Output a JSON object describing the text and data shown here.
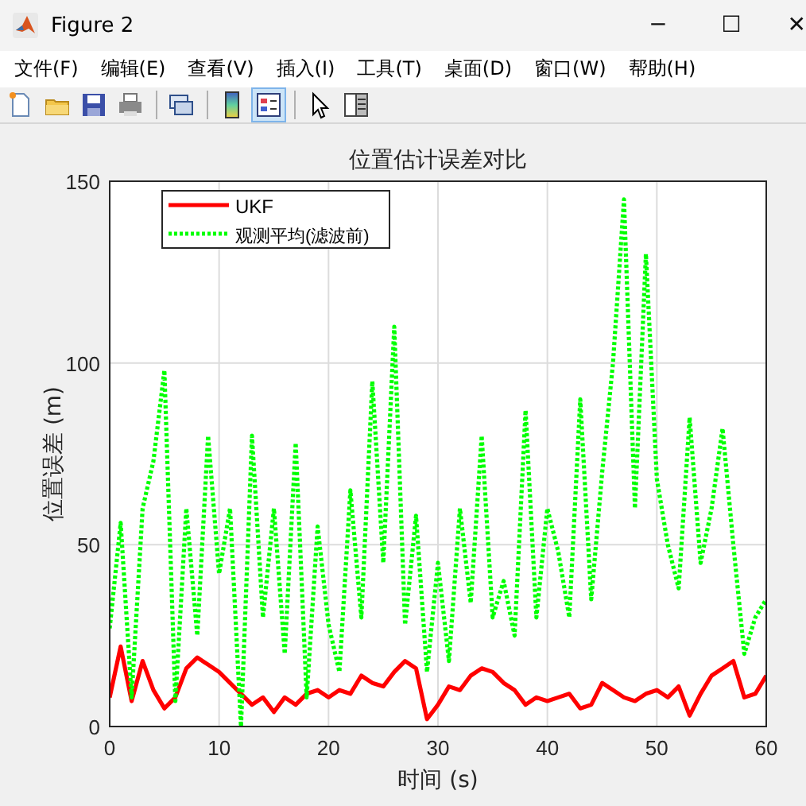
{
  "window": {
    "title": "Figure 2",
    "controls": [
      "─",
      "☐",
      "✕"
    ]
  },
  "menu": [
    "文件(F)",
    "编辑(E)",
    "查看(V)",
    "插入(I)",
    "工具(T)",
    "桌面(D)",
    "窗口(W)",
    "帮助(H)"
  ],
  "toolbar": [
    {
      "selected": false
    },
    {
      "selected": false
    },
    {
      "selected": false
    },
    {
      "selected": false
    },
    {
      "selected": false
    },
    {
      "selected": false
    },
    {
      "selected": true
    },
    {
      "selected": false
    },
    {
      "selected": false
    }
  ],
  "plot": {
    "chart_data": {
      "type": "line",
      "title": "位置估计误差对比",
      "xlabel": "时间 (s)",
      "ylabel": "位置误差 (m)",
      "x": [
        0,
        1,
        2,
        3,
        4,
        5,
        6,
        7,
        8,
        9,
        10,
        11,
        12,
        13,
        14,
        15,
        16,
        17,
        18,
        19,
        20,
        21,
        22,
        23,
        24,
        25,
        26,
        27,
        28,
        29,
        30,
        31,
        32,
        33,
        34,
        35,
        36,
        37,
        38,
        39,
        40,
        41,
        42,
        43,
        44,
        45,
        46,
        47,
        48,
        49,
        50,
        51,
        52,
        53,
        54,
        55,
        56,
        57,
        58,
        59,
        60
      ],
      "series": [
        {
          "name": "UKF",
          "color": "#ff0000",
          "line_style": "solid",
          "values": [
            8,
            22,
            7,
            18,
            10,
            5,
            8,
            16,
            19,
            17,
            15,
            12,
            9,
            6,
            8,
            4,
            8,
            6,
            9,
            10,
            8,
            10,
            9,
            14,
            12,
            11,
            15,
            18,
            16,
            2,
            6,
            11,
            10,
            14,
            16,
            15,
            12,
            10,
            6,
            8,
            7,
            8,
            9,
            5,
            6,
            12,
            10,
            8,
            7,
            9,
            10,
            8,
            11,
            3,
            9,
            14,
            16,
            18,
            8,
            9,
            14
          ]
        },
        {
          "name": "观测平均(滤波前)",
          "color": "#00ff00",
          "line_style": "dotted",
          "values": [
            27,
            56,
            8,
            60,
            73,
            98,
            7,
            60,
            25,
            80,
            42,
            60,
            0,
            80,
            30,
            60,
            20,
            78,
            8,
            55,
            28,
            15,
            65,
            30,
            95,
            45,
            110,
            28,
            58,
            15,
            45,
            18,
            60,
            34,
            80,
            30,
            40,
            25,
            87,
            30,
            60,
            48,
            30,
            90,
            35,
            70,
            100,
            145,
            60,
            130,
            68,
            50,
            38,
            85,
            45,
            60,
            82,
            50,
            20,
            30,
            35
          ]
        }
      ],
      "grid": true,
      "legend": "upper left",
      "xlim": [
        0,
        60
      ],
      "ylim": [
        0,
        150
      ],
      "xticks": [
        0,
        10,
        20,
        30,
        40,
        50,
        60
      ],
      "yticks": [
        0,
        50,
        100,
        150
      ]
    }
  }
}
